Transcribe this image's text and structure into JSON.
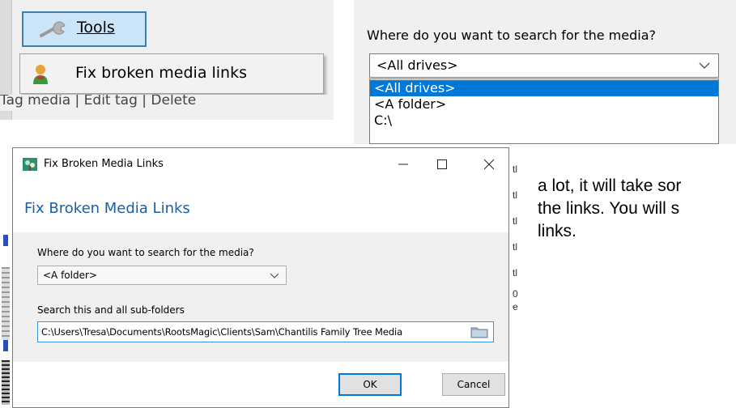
{
  "tools_panel": {
    "tools_label": "Tools",
    "menu_item": "Fix broken media links",
    "tag_strip": "Tag media  |     Edit tag    |   Delete"
  },
  "dropdown_panel": {
    "question": "Where do you want to search for the media?",
    "selected": "<All drives>",
    "options": [
      "<All drives>",
      "<A folder>",
      "C:\\"
    ]
  },
  "dialog": {
    "window_title": "Fix Broken Media Links",
    "heading": "Fix Broken Media Links",
    "search_label": "Where do you want to search for the media?",
    "search_value": "<A folder>",
    "folder_label": "Search this and all sub-folders",
    "folder_path": "C:\\Users\\Tresa\\Documents\\RootsMagic\\Clients\\Sam\\Chantilis Family Tree Media",
    "ok_label": "OK",
    "cancel_label": "Cancel"
  },
  "background": {
    "line1": "a lot, it will take sor",
    "line2": "the links. You will s",
    "line3": "links."
  },
  "colors": {
    "highlight": "#0078d7",
    "heading_blue": "#1a5fa5",
    "menu_hover": "#cce4f7"
  }
}
